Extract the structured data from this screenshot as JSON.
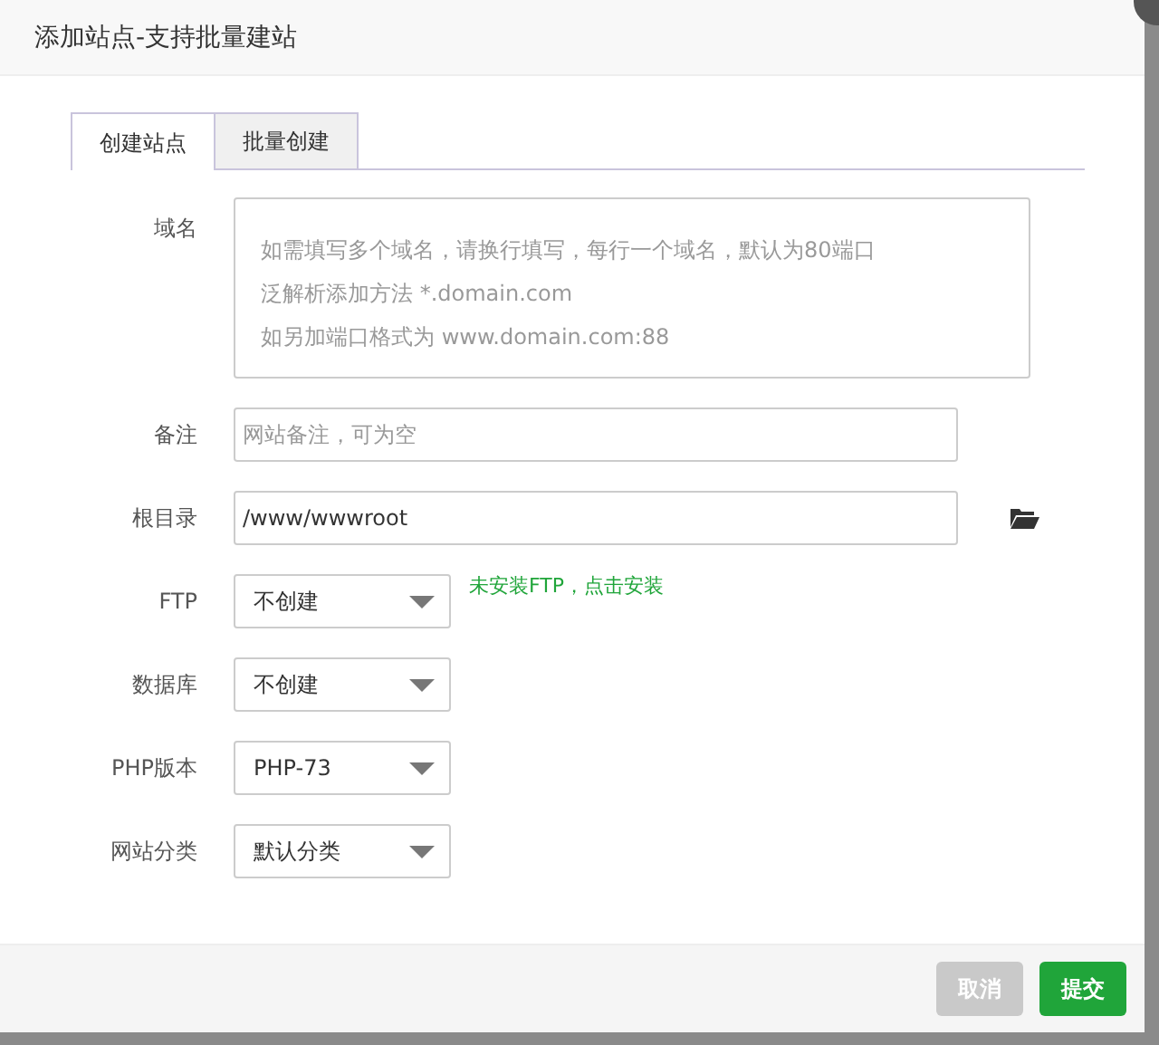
{
  "window": {
    "title": "添加站点-支持批量建站"
  },
  "tabs": [
    {
      "label": "创建站点",
      "selected": true
    },
    {
      "label": "批量创建",
      "selected": false
    }
  ],
  "fields": [
    {
      "kind": "textarea",
      "label": "域名",
      "placeholder": [
        "如需填写多个域名，请换行填写，每行一个域名，默认为80端口",
        "泛解析添加方法 *.domain.com",
        "如另加端口格式为 www.domain.com:88"
      ]
    },
    {
      "kind": "input",
      "label": "备注",
      "placeholder": "网站备注，可为空"
    },
    {
      "kind": "path",
      "label": "根目录",
      "value": "/www/wwwroot"
    },
    {
      "kind": "select",
      "label": "FTP",
      "value": "不创建",
      "note": "未安装FTP，点击安装"
    },
    {
      "kind": "select",
      "label": "数据库",
      "value": "不创建"
    },
    {
      "kind": "select",
      "label": "PHP版本",
      "value": "PHP-73"
    },
    {
      "kind": "select",
      "label": "网站分类",
      "value": "默认分类"
    }
  ],
  "buttons": [
    {
      "label": "取消",
      "kind": "cancel"
    },
    {
      "label": "提交",
      "kind": "primary"
    }
  ]
}
